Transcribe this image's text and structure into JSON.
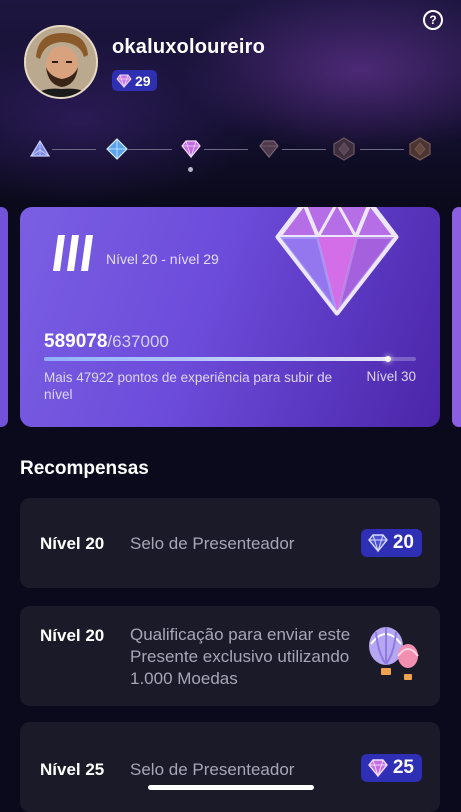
{
  "header": {
    "username": "okaluxoloureiro",
    "level": "29",
    "help_icon": "?"
  },
  "level_track": {
    "tiers": [
      "tier-1-gem-icon",
      "tier-2-gem-icon",
      "tier-3-gem-icon",
      "tier-4-gem-icon",
      "tier-5-gem-icon",
      "tier-6-gem-icon"
    ],
    "active_index": 2
  },
  "level_card": {
    "roman": "III",
    "range": "Nível 20 - nível 29",
    "xp_current": "589078",
    "xp_total": "/637000",
    "progress": 0.925,
    "hint": "Mais 47922 pontos de experiência para subir de nível",
    "next_level": "Nível 30"
  },
  "rewards": {
    "title": "Recompensas",
    "items": [
      {
        "level": "Nível 20",
        "description": "Selo de Presenteador",
        "badge": "20"
      },
      {
        "level": "Nível 20",
        "description": "Qualificação para enviar este Presente exclusivo utilizando 1.000 Moedas"
      },
      {
        "level": "Nível 25",
        "description": "Selo de Presenteador",
        "badge": "25"
      }
    ]
  },
  "colors": {
    "accent": "#2f2fb6",
    "card": "#6c4bda",
    "background": "#0b0a1c"
  }
}
